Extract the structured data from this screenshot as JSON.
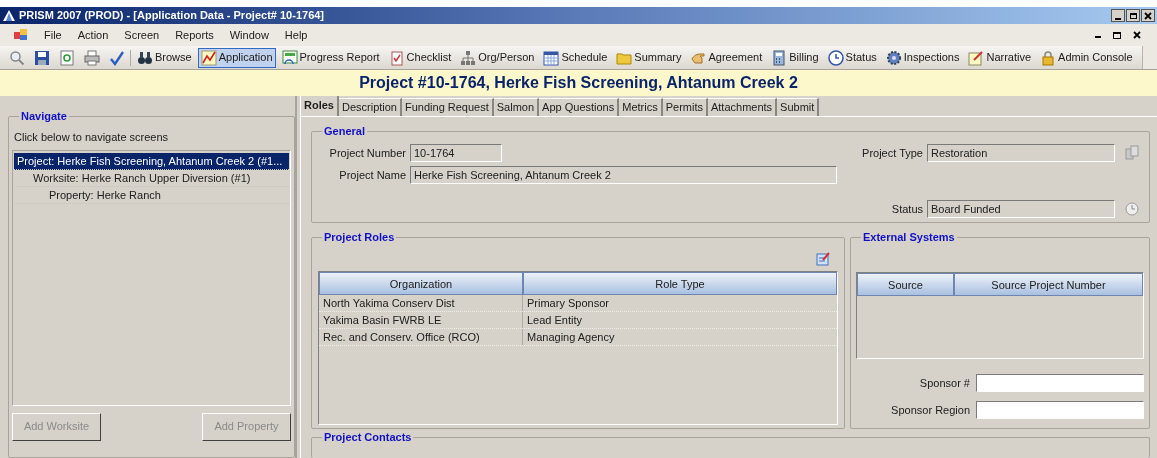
{
  "window": {
    "title": "PRISM 2007 (PROD) - [Application Data - Project# 10-1764]"
  },
  "menu": [
    "File",
    "Action",
    "Screen",
    "Reports",
    "Window",
    "Help"
  ],
  "toolbar": [
    {
      "kind": "icon"
    },
    {
      "kind": "icon"
    },
    {
      "kind": "icon"
    },
    {
      "kind": "icon"
    },
    {
      "kind": "icon"
    },
    {
      "kind": "button",
      "label": "Browse",
      "selected": false
    },
    {
      "kind": "button",
      "label": "Application",
      "selected": true
    },
    {
      "kind": "button",
      "label": "Progress Report",
      "selected": false
    },
    {
      "kind": "button",
      "label": "Checklist",
      "selected": false
    },
    {
      "kind": "button",
      "label": "Org/Person",
      "selected": false
    },
    {
      "kind": "button",
      "label": "Schedule",
      "selected": false
    },
    {
      "kind": "button",
      "label": "Summary",
      "selected": false
    },
    {
      "kind": "button",
      "label": "Agreement",
      "selected": false
    },
    {
      "kind": "button",
      "label": "Billing",
      "selected": false
    },
    {
      "kind": "button",
      "label": "Status",
      "selected": false
    },
    {
      "kind": "button",
      "label": "Inspections",
      "selected": false
    },
    {
      "kind": "button",
      "label": "Narrative",
      "selected": false
    },
    {
      "kind": "button",
      "label": "Admin Console",
      "selected": false
    }
  ],
  "project_title": "Project #10-1764, Herke Fish Screening, Ahtanum Creek 2",
  "tabs": [
    {
      "label": "Roles",
      "selected": true
    },
    {
      "label": "Description",
      "selected": false
    },
    {
      "label": "Funding Request",
      "selected": false
    },
    {
      "label": "Salmon",
      "selected": false
    },
    {
      "label": "App Questions",
      "selected": false
    },
    {
      "label": "Metrics",
      "selected": false
    },
    {
      "label": "Permits",
      "selected": false
    },
    {
      "label": "Attachments",
      "selected": false
    },
    {
      "label": "Submit",
      "selected": false
    }
  ],
  "navigate": {
    "title": "Navigate",
    "hint": "Click below to navigate screens",
    "tree": [
      {
        "label": "Project: Herke Fish Screening, Ahtanum Creek 2 (#1...",
        "selected": true,
        "children": [
          {
            "label": "Worksite: Herke Ranch Upper Diversion (#1)",
            "selected": false,
            "children": [
              {
                "label": "Property: Herke Ranch",
                "selected": false
              }
            ]
          }
        ]
      }
    ],
    "buttons": [
      {
        "label": "Add Worksite",
        "disabled": true
      },
      {
        "label": "Add Property",
        "disabled": true
      }
    ]
  },
  "general": {
    "title": "General",
    "project_number": {
      "label": "Project Number",
      "value": "10-1764"
    },
    "project_name": {
      "label": "Project Name",
      "value": "Herke Fish Screening, Ahtanum Creek 2"
    },
    "project_type": {
      "label": "Project Type",
      "value": "Restoration"
    },
    "status": {
      "label": "Status",
      "value": "Board Funded"
    }
  },
  "project_roles": {
    "title": "Project Roles",
    "columns": [
      "Organization",
      "Role Type"
    ],
    "rows": [
      [
        "North Yakima Conserv Dist",
        "Primary Sponsor"
      ],
      [
        "Yakima Basin FWRB LE",
        "Lead Entity"
      ],
      [
        "Rec. and Conserv. Office (RCO)",
        "Managing Agency"
      ]
    ]
  },
  "external_systems": {
    "title": "External Systems",
    "columns": [
      "Source",
      "Source Project Number"
    ],
    "sponsor_number": {
      "label": "Sponsor #"
    },
    "sponsor_region": {
      "label": "Sponsor Region"
    }
  },
  "project_contacts": {
    "title": "Project Contacts"
  }
}
